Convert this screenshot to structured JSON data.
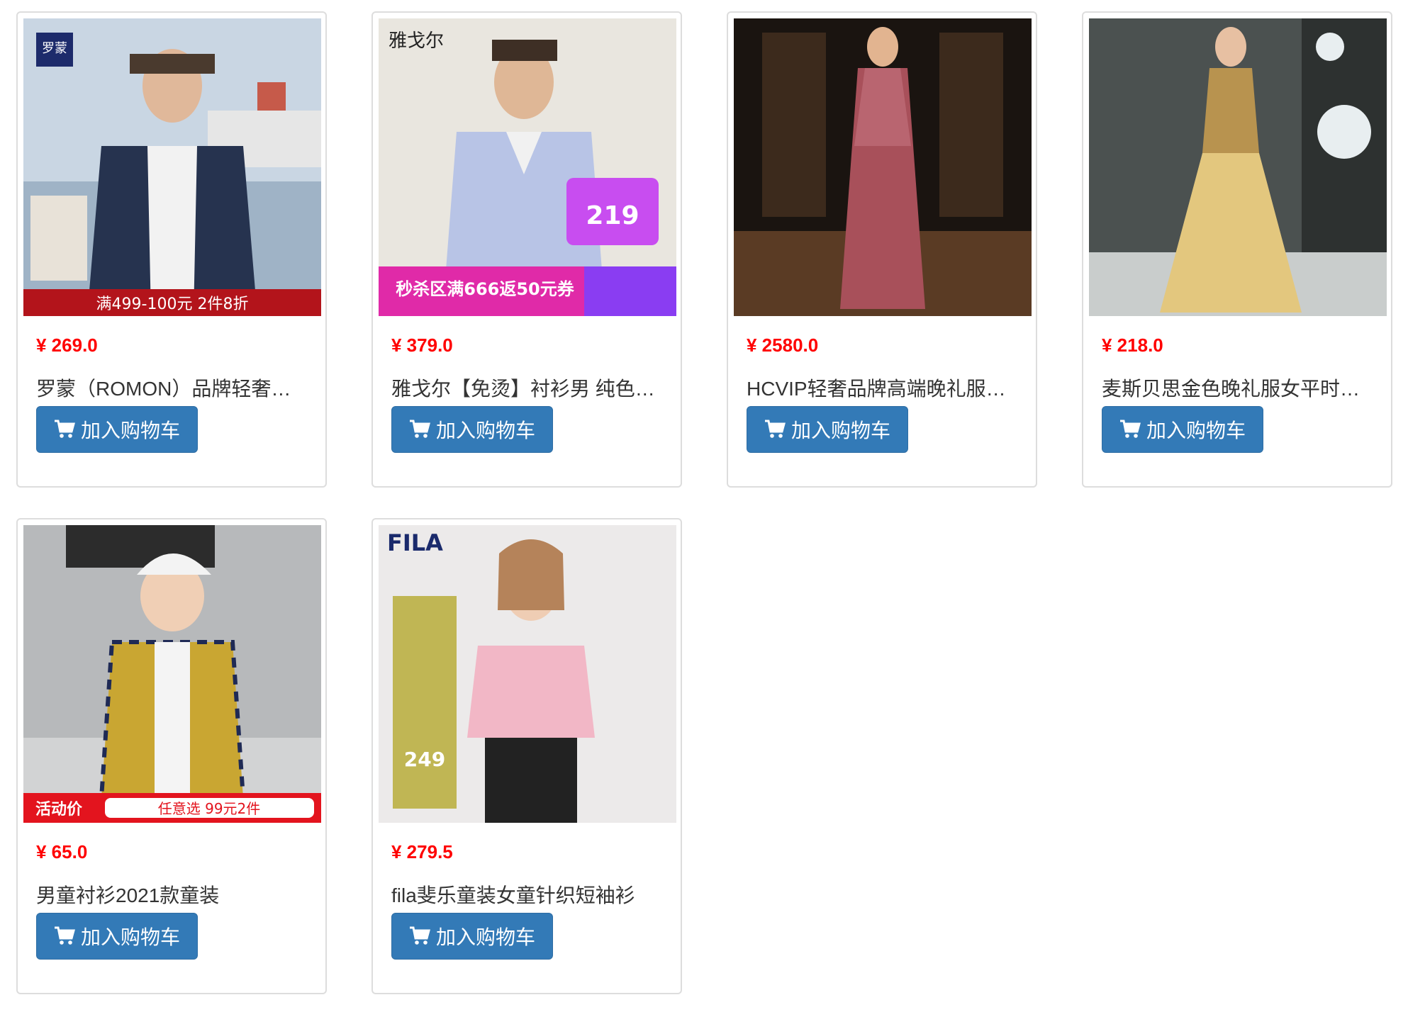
{
  "products": [
    {
      "price": "¥ 269.0",
      "title": "罗蒙（ROMON）品牌轻奢…",
      "button": "加入购物车",
      "image_text": "满499-100元 2件8折",
      "brand_logo": "罗蒙"
    },
    {
      "price": "¥ 379.0",
      "title": "雅戈尔【免烫】衬衫男 纯色…",
      "button": "加入购物车",
      "image_text": "秒杀区满666返50元券",
      "brand_logo": "雅戈尔"
    },
    {
      "price": "¥ 2580.0",
      "title": "HCVIP轻奢品牌高端晚礼服…",
      "button": "加入购物车"
    },
    {
      "price": "¥ 218.0",
      "title": "麦斯贝思金色晚礼服女平时…",
      "button": "加入购物车"
    },
    {
      "price": "¥ 65.0",
      "title": "男童衬衫2021款童装",
      "button": "加入购物车",
      "image_text": "活动价",
      "image_text_2": "任意选 99元2件"
    },
    {
      "price": "¥ 279.5",
      "title": "fila斐乐童装女童针织短袖衫",
      "button": "加入购物车",
      "brand_logo": "FILA",
      "image_text": "249"
    }
  ],
  "colors": {
    "price": "#ff0000",
    "button_bg": "#337ab7",
    "button_border": "#2e6da4",
    "title": "#333333",
    "card_border": "#dddddd"
  },
  "icons": {
    "button_icon": "shopping-cart-icon"
  }
}
